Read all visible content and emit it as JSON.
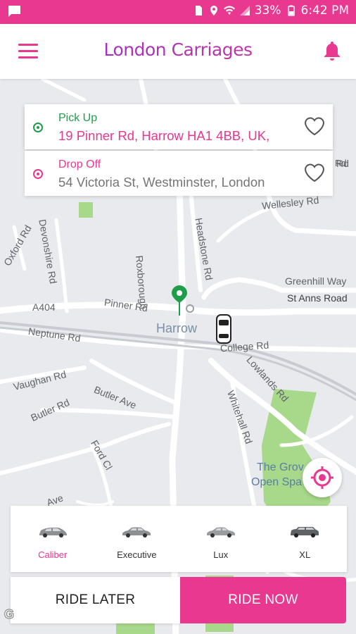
{
  "status_bar": {
    "battery": "33%",
    "time": "6:42 PM",
    "icons": [
      "chat-icon",
      "sim-icon",
      "location-icon",
      "wifi-icon",
      "signal-icon",
      "battery-icon"
    ]
  },
  "header": {
    "title": "London Carriages",
    "menu_icon": "hamburger-icon",
    "notification_icon": "bell-icon"
  },
  "pickup": {
    "label": "Pick Up",
    "address": "19 Pinner Rd, Harrow HA1 4BB, UK,"
  },
  "dropoff": {
    "label": "Drop Off",
    "address": "54 Victoria St, Westminster, London"
  },
  "map_labels": {
    "harrow": "Harrow",
    "pinner_rd": "Pinner Rd",
    "a404": "A404",
    "neptune_rd": "Neptune Rd",
    "college_rd": "College Rd",
    "roxborough": "Roxborough",
    "headstone_rd": "Headstone Rd",
    "greenhill_way": "Greenhill Way",
    "st_anns_road": "St Anns Road",
    "wellesley_rd": "Wellesley Rd",
    "devonshire_rd": "Devonshire Rd",
    "oxford_rd": "Oxford Rd",
    "vaughan_rd": "Vaughan Rd",
    "butler_rd": "Butler Rd",
    "butler_ave": "Butler Ave",
    "ford_cl": "Ford Cl",
    "lowlands_rd": "Lowlands Rd",
    "whitehall_rd": "Whitehall Rd",
    "the_grove": "The Grov",
    "open_space": "Open Spa",
    "ave": "Ave",
    "rd": "Rd",
    "st_anns_rd": "St Anns Rd",
    "google": "Google"
  },
  "car_types": [
    {
      "name": "Caliber",
      "selected": true
    },
    {
      "name": "Executive",
      "selected": false
    },
    {
      "name": "Lux",
      "selected": false
    },
    {
      "name": "XL",
      "selected": false
    }
  ],
  "actions": {
    "ride_later": "RIDE LATER",
    "ride_now": "RIDE NOW"
  },
  "colors": {
    "accent": "#e8388f",
    "pickup_green": "#1e9e4a",
    "title_gradient_start": "#8e2bd6"
  }
}
